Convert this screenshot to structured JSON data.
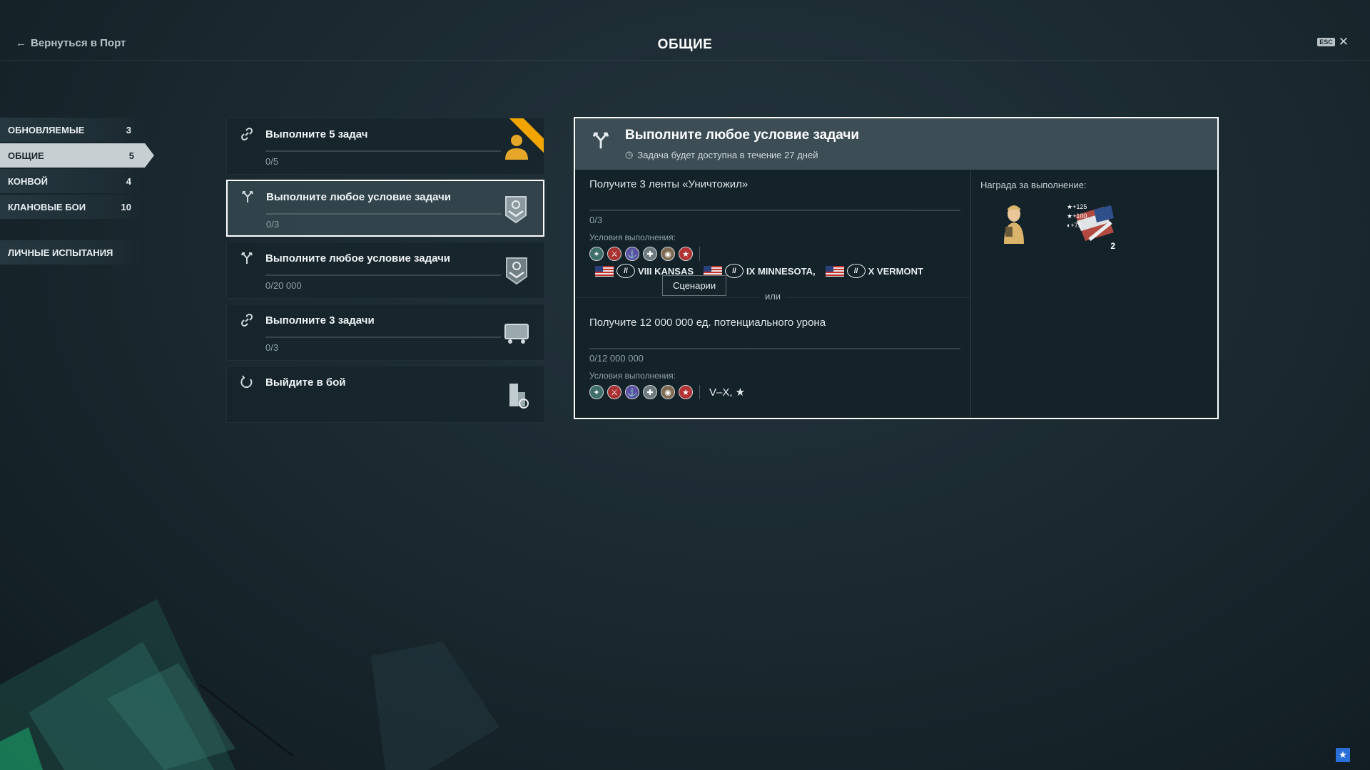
{
  "header": {
    "back_label": "Вернуться в Порт",
    "title": "ОБЩИЕ",
    "esc_label": "ESC"
  },
  "nav": {
    "items": [
      {
        "label": "ОБНОВЛЯЕМЫЕ",
        "count": "3"
      },
      {
        "label": "ОБЩИЕ",
        "count": "5"
      },
      {
        "label": "КОНВОЙ",
        "count": "4"
      },
      {
        "label": "КЛАНОВЫЕ БОИ",
        "count": "10"
      }
    ],
    "personal": {
      "label": "ЛИЧНЫЕ ИСПЫТАНИЯ"
    }
  },
  "tasks": [
    {
      "title": "Выполните 5 задач",
      "progress": "0/5",
      "icon": "chain-link-icon",
      "reward": "commander-icon"
    },
    {
      "title": "Выполните любое условие задачи",
      "progress": "0/3",
      "icon": "fork-icon",
      "reward": "rank-chevron-icon"
    },
    {
      "title": "Выполните любое условие задачи",
      "progress": "0/20 000",
      "icon": "fork-icon",
      "reward": "rank-chevron-icon"
    },
    {
      "title": "Выполните 3 задачи",
      "progress": "0/3",
      "icon": "chain-link-icon",
      "reward": "container-icon"
    },
    {
      "title": "Выйдите в бой",
      "icon": "refresh-icon",
      "reward": "credits-stack-icon"
    }
  ],
  "detail": {
    "title": "Выполните любое условие задачи",
    "subtitle": "Задача будет доступна в течение 27 дней",
    "conditions": [
      {
        "title": "Получите 3 ленты «Уничтожил»",
        "progress": "0/3",
        "label": "Условия выполнения:",
        "ships": [
          {
            "tier": "VIII",
            "name": "KANSAS"
          },
          {
            "tier": "IX",
            "name": "MINNESOTA,"
          },
          {
            "tier": "X",
            "name": "VERMONT"
          }
        ],
        "tooltip": "Сценарии"
      },
      {
        "title": "Получите 12 000 000 ед. потенциального урона",
        "progress": "0/12 000 000",
        "label": "Условия выполнения:",
        "tier_range": "V–X, ★"
      }
    ],
    "or_label": "или",
    "reward": {
      "label": "Награда за выполнение:",
      "stats": [
        "+125",
        "+100",
        "+75"
      ],
      "count": "2"
    }
  },
  "colors": {
    "accent": "#f2a500",
    "selected_border": "#ffffff",
    "nav_active": "#c7cfd2",
    "corner_badge": "#2a6fd8"
  }
}
